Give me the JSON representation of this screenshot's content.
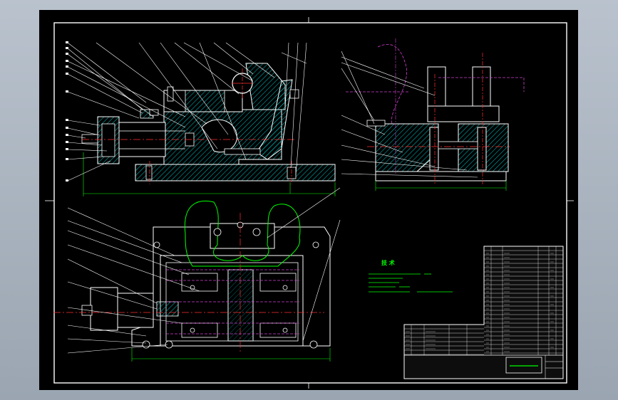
{
  "drawing": {
    "technical_requirements_title": "技 术",
    "colors": {
      "background": "#000000",
      "outline": "#ffffff",
      "frame": "#ffffff",
      "hatch": "#00a8a8",
      "center_line": "#ff3030",
      "hidden_line": "#d040d0",
      "workpiece": "#00ff00",
      "leader": "#ffffff",
      "text_green": "#00ff00",
      "dimension": "#00ff00",
      "title_block_fill": "#1a1a1a"
    }
  }
}
